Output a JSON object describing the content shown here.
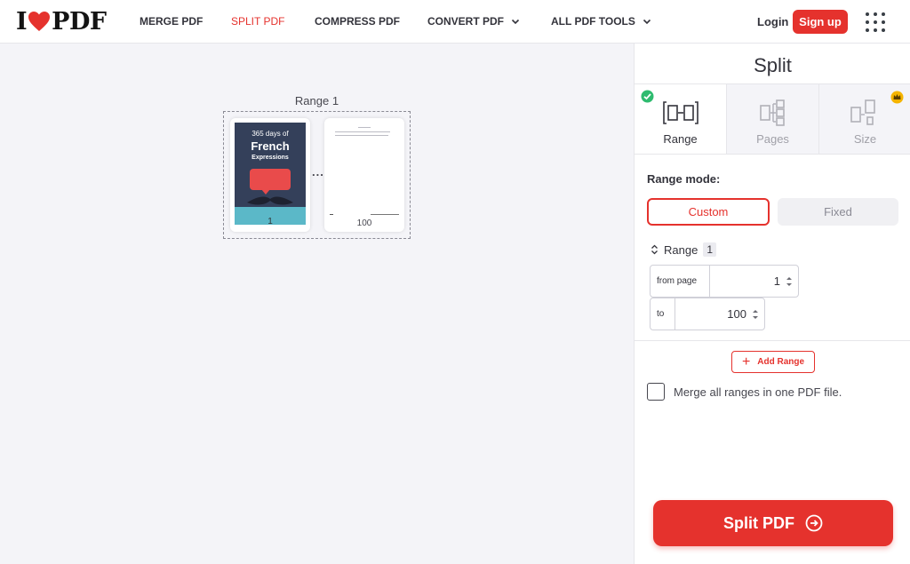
{
  "header": {
    "logo_left": "I",
    "logo_right": "PDF",
    "nav": [
      {
        "label": "MERGE PDF",
        "active": false,
        "dropdown": false
      },
      {
        "label": "SPLIT PDF",
        "active": true,
        "dropdown": false
      },
      {
        "label": "COMPRESS PDF",
        "active": false,
        "dropdown": false
      },
      {
        "label": "CONVERT PDF",
        "active": false,
        "dropdown": true
      },
      {
        "label": "ALL PDF TOOLS",
        "active": false,
        "dropdown": true
      }
    ],
    "login": "Login",
    "signup": "Sign up"
  },
  "preview": {
    "range_title": "Range 1",
    "thumbnails": [
      {
        "page_number": "1",
        "cover_line1": "365 days of",
        "cover_line2": "French",
        "cover_line3": "Expressions"
      },
      {
        "page_number": "100"
      }
    ],
    "ellipsis": "..."
  },
  "sidebar": {
    "title": "Split",
    "tabs": [
      {
        "label": "Range",
        "active": true,
        "icon": "range-split-icon"
      },
      {
        "label": "Pages",
        "active": false,
        "icon": "pages-split-icon"
      },
      {
        "label": "Size",
        "active": false,
        "icon": "size-split-icon",
        "premium": true
      }
    ],
    "range_mode_label": "Range mode:",
    "mode_custom": "Custom",
    "mode_fixed": "Fixed",
    "range_label": "Range",
    "range_number": "1",
    "from_label": "from page",
    "from_value": "1",
    "to_label": "to",
    "to_value": "100",
    "add_range": "Add Range",
    "merge_label": "Merge all ranges in one PDF file.",
    "split_button": "Split PDF"
  },
  "colors": {
    "brand": "#e5322d",
    "check": "#2ebb6f",
    "crown": "#f5b400"
  }
}
